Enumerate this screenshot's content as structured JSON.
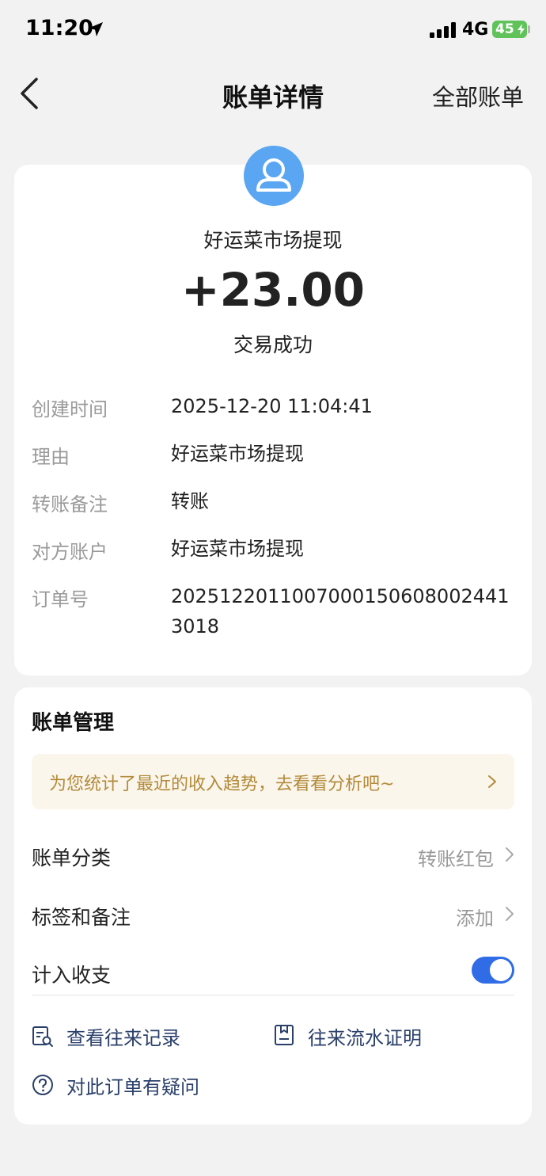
{
  "status_bar": {
    "time": "11:20",
    "network": "4G",
    "battery": "45",
    "icons": [
      "location-arrow-icon",
      "signal-bars-icon",
      "battery-charging-icon"
    ]
  },
  "nav": {
    "title": "账单详情",
    "right_label": "全部账单",
    "back_icon": "chevron-left-icon"
  },
  "summary": {
    "merchant": "好运菜市场提现",
    "amount": "+23.00",
    "status": "交易成功",
    "avatar_icon": "user-avatar-icon",
    "avatar_color": "#5aa6f2"
  },
  "details": [
    {
      "label": "创建时间",
      "value": "2025-12-20 11:04:41"
    },
    {
      "label": "理由",
      "value": "好运菜市场提现"
    },
    {
      "label": "转账备注",
      "value": "转账"
    },
    {
      "label": "对方账户",
      "value": "好运菜市场提现"
    },
    {
      "label": "订单号",
      "value": "20251220110070001506080024413018"
    }
  ],
  "management": {
    "title": "账单管理",
    "banner_text": "为您统计了最近的收入趋势，去看看分析吧~",
    "items": [
      {
        "label": "账单分类",
        "value": "转账红包"
      },
      {
        "label": "标签和备注",
        "value": "添加"
      },
      {
        "label": "计入收支",
        "toggle_on": true
      }
    ],
    "actions": [
      {
        "label": "查看往来记录",
        "icon": "record-search-icon"
      },
      {
        "label": "往来流水证明",
        "icon": "document-proof-icon"
      },
      {
        "label": "对此订单有疑问",
        "icon": "question-circle-icon"
      }
    ]
  },
  "colors": {
    "accent": "#2f6ce5",
    "banner_text": "#b38a3a",
    "label_gray": "#9a9a9a",
    "action_text": "#2a3f6a"
  }
}
